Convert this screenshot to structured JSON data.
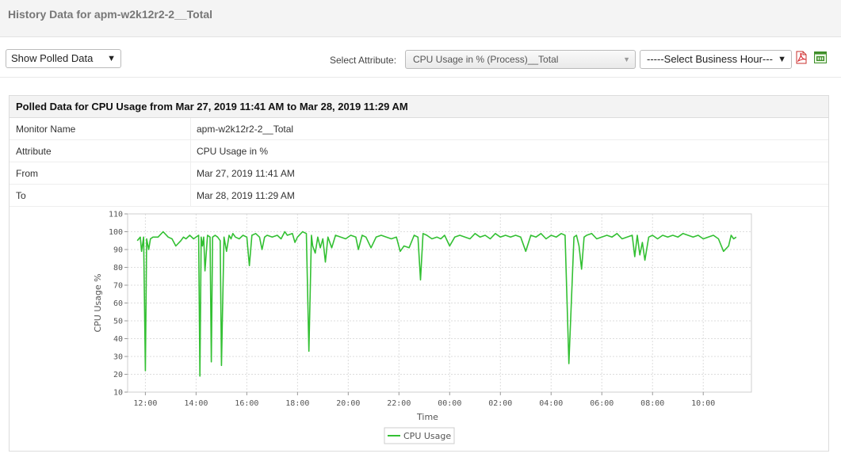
{
  "header": {
    "title": "History Data for apm-w2k12r2-2__Total"
  },
  "toolbar": {
    "polled_select": "Show Polled Data",
    "attribute_label": "Select Attribute:",
    "attribute_select": "CPU Usage in % (Process)__Total",
    "business_hour_select": "-----Select Business Hour---",
    "icons": [
      "pdf-icon",
      "csv-icon"
    ]
  },
  "panel": {
    "title": "Polled Data for CPU Usage from Mar 27, 2019 11:41 AM to Mar 28, 2019 11:29 AM",
    "rows": [
      {
        "label": "Monitor Name",
        "value": "apm-w2k12r2-2__Total"
      },
      {
        "label": "Attribute",
        "value": "CPU Usage in %"
      },
      {
        "label": "From",
        "value": "Mar 27, 2019 11:41 AM"
      },
      {
        "label": "To",
        "value": "Mar 28, 2019 11:29 AM"
      }
    ]
  },
  "colors": {
    "series": "#33c033",
    "grid": "#dddddd"
  },
  "chart_data": {
    "type": "line",
    "xlabel": "Time",
    "ylabel": "CPU Usage %",
    "x_ticks": [
      "12:00",
      "14:00",
      "16:00",
      "18:00",
      "20:00",
      "22:00",
      "00:00",
      "02:00",
      "04:00",
      "06:00",
      "08:00",
      "10:00"
    ],
    "y_ticks": [
      10,
      20,
      30,
      40,
      50,
      60,
      70,
      80,
      90,
      100,
      110
    ],
    "ylim": [
      10,
      110
    ],
    "xlim_hours": [
      11.3,
      35.9
    ],
    "grid": true,
    "legend_position": "bottom",
    "series": [
      {
        "name": "CPU Usage",
        "hours": [
          11.68,
          11.8,
          11.85,
          11.93,
          12.0,
          12.05,
          12.13,
          12.2,
          12.3,
          12.5,
          12.7,
          12.9,
          13.05,
          13.2,
          13.4,
          13.5,
          13.6,
          13.75,
          13.9,
          14.1,
          14.15,
          14.2,
          14.25,
          14.3,
          14.35,
          14.45,
          14.55,
          14.6,
          14.65,
          14.75,
          14.85,
          14.95,
          15.0,
          15.1,
          15.2,
          15.3,
          15.38,
          15.45,
          15.55,
          15.7,
          15.85,
          16.0,
          16.1,
          16.2,
          16.35,
          16.5,
          16.6,
          16.7,
          16.8,
          17.0,
          17.2,
          17.35,
          17.5,
          17.6,
          17.8,
          17.9,
          18.0,
          18.2,
          18.35,
          18.45,
          18.55,
          18.6,
          18.7,
          18.8,
          18.9,
          19.0,
          19.1,
          19.2,
          19.35,
          19.5,
          19.7,
          19.9,
          20.1,
          20.3,
          20.4,
          20.55,
          20.7,
          20.9,
          21.1,
          21.3,
          21.5,
          21.7,
          21.9,
          22.05,
          22.2,
          22.4,
          22.6,
          22.75,
          22.85,
          22.95,
          23.1,
          23.3,
          23.5,
          23.65,
          23.8,
          24.0,
          24.2,
          24.4,
          24.6,
          24.8,
          25.0,
          25.2,
          25.4,
          25.6,
          25.8,
          26.0,
          26.2,
          26.4,
          26.6,
          26.8,
          27.0,
          27.2,
          27.4,
          27.6,
          27.8,
          28.0,
          28.2,
          28.4,
          28.55,
          28.7,
          28.9,
          29.0,
          29.1,
          29.2,
          29.3,
          29.4,
          29.6,
          29.8,
          30.0,
          30.2,
          30.4,
          30.6,
          30.8,
          31.0,
          31.2,
          31.3,
          31.4,
          31.5,
          31.6,
          31.7,
          31.85,
          32.0,
          32.2,
          32.4,
          32.6,
          32.8,
          33.0,
          33.2,
          33.4,
          33.6,
          33.8,
          34.0,
          34.2,
          34.4,
          34.6,
          34.8,
          35.0,
          35.1,
          35.2,
          35.3,
          35.4,
          35.5
        ],
        "values": [
          95,
          97,
          89,
          97,
          22,
          96,
          90,
          96,
          97,
          97,
          100,
          97,
          96,
          92,
          95,
          97,
          96,
          98,
          96,
          98,
          19,
          97,
          92,
          97,
          78,
          98,
          97,
          27,
          97,
          98,
          97,
          95,
          25,
          97,
          89,
          98,
          96,
          99,
          97,
          96,
          98,
          97,
          81,
          98,
          99,
          97,
          90,
          97,
          98,
          97,
          98,
          96,
          100,
          98,
          99,
          94,
          97,
          100,
          99,
          33,
          98,
          92,
          88,
          97,
          91,
          96,
          83,
          97,
          91,
          98,
          97,
          96,
          98,
          97,
          90,
          98,
          97,
          91,
          97,
          98,
          97,
          96,
          97,
          89,
          92,
          91,
          98,
          97,
          73,
          99,
          98,
          96,
          97,
          96,
          98,
          92,
          97,
          98,
          97,
          96,
          99,
          97,
          98,
          96,
          99,
          97,
          98,
          97,
          98,
          97,
          89,
          98,
          97,
          99,
          96,
          98,
          97,
          99,
          98,
          26,
          97,
          98,
          92,
          79,
          97,
          98,
          99,
          96,
          97,
          98,
          97,
          99,
          96,
          97,
          98,
          86,
          98,
          87,
          94,
          84,
          97,
          98,
          96,
          98,
          97,
          98,
          97,
          99,
          98,
          97,
          98,
          96,
          97,
          98,
          96,
          89,
          92,
          98,
          96,
          97
        ]
      }
    ]
  }
}
